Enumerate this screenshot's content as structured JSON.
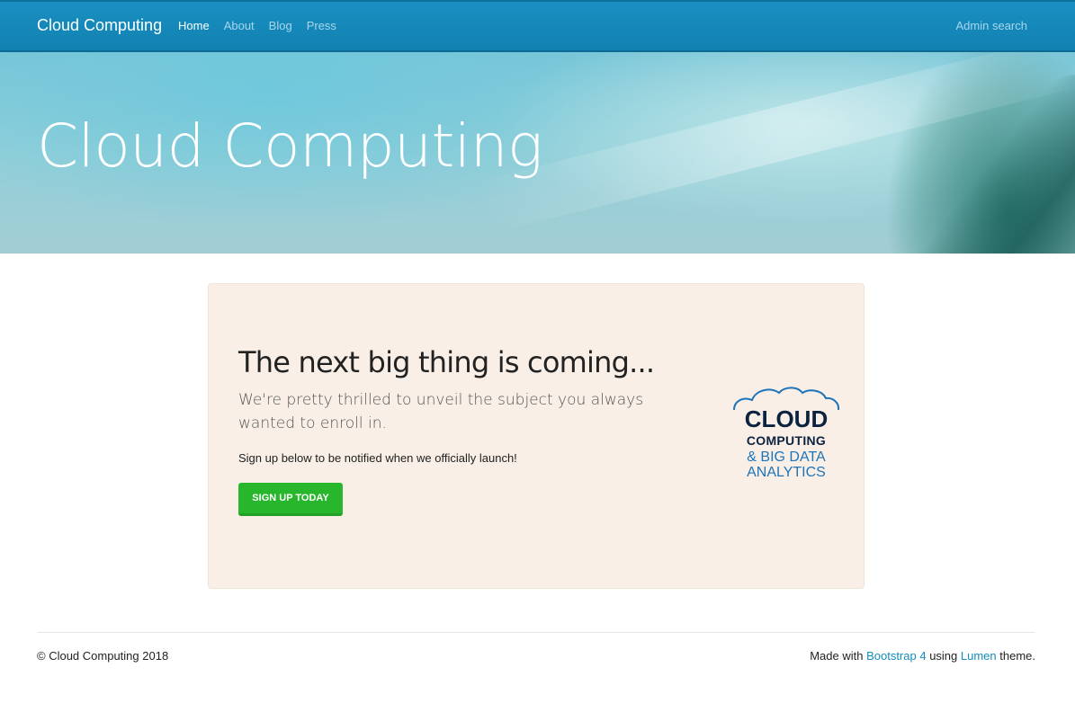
{
  "navbar": {
    "brand": "Cloud Computing",
    "items": [
      {
        "label": "Home",
        "active": true
      },
      {
        "label": "About",
        "active": false
      },
      {
        "label": "Blog",
        "active": false
      },
      {
        "label": "Press",
        "active": false
      }
    ],
    "right_link": "Admin search"
  },
  "hero": {
    "title": "Cloud Computing"
  },
  "card": {
    "heading": "The next big thing is coming...",
    "lead": "We're pretty thrilled to unveil the subject you always wanted to enroll in.",
    "note": "Sign up below to be notified when we officially launch!",
    "button_label": "SIGN UP TODAY",
    "logo": {
      "line1": "CLOUD",
      "line2": "COMPUTING",
      "line3": "& BIG DATA",
      "line4": "ANALYTICS"
    }
  },
  "footer": {
    "copyright": "© Cloud Computing 2018",
    "made_with_prefix": "Made with ",
    "bootstrap_link": "Bootstrap 4",
    "using_text": " using ",
    "theme_link": "Lumen",
    "suffix": " theme."
  },
  "colors": {
    "navbar": "#158cba",
    "accent_green": "#28b62c",
    "card_bg": "#f9efe6",
    "link": "#158cba",
    "logo_dark": "#0c2340",
    "logo_blue": "#1c74bb"
  }
}
